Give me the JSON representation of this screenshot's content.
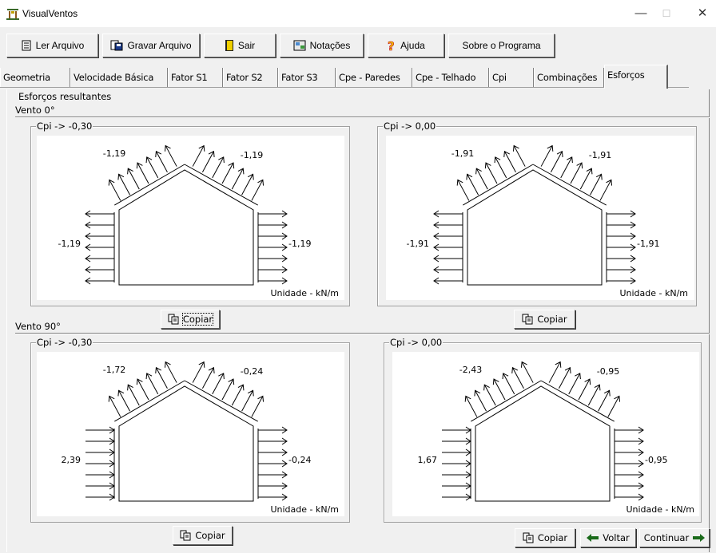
{
  "window": {
    "title": "VisualVentos",
    "minimize_glyph": "—",
    "maximize_glyph": "☐",
    "close_glyph": "✕"
  },
  "toolbar": {
    "open_label": "Ler Arquivo",
    "save_label": "Gravar Arquivo",
    "exit_label": "Sair",
    "notation_label": "Notações",
    "help_label": "Ajuda",
    "about_label": "Sobre o Programa"
  },
  "tabs": [
    "Geometria",
    "Velocidade Básica",
    "Fator S1",
    "Fator S2",
    "Fator S3",
    "Cpe - Paredes",
    "Cpe - Telhado",
    "Cpi",
    "Combinações",
    "Esforços"
  ],
  "active_tab": "Esforços",
  "panel_title": "Esforços resultantes",
  "unit_label": "Unidade - kN/m",
  "copy_label": "Copiar",
  "back_label": "Voltar",
  "continue_label": "Continuar",
  "sections": [
    {
      "title": "Vento 0°",
      "diagrams": [
        {
          "cpi_label": "Cpi -> -0,30",
          "left_wall": "-1,19",
          "right_wall": "-1,19",
          "left_roof": "-1,19",
          "right_roof": "-1,19",
          "left_wall_arrows": "out",
          "right_wall_arrows": "out"
        },
        {
          "cpi_label": "Cpi -> 0,00",
          "left_wall": "-1,91",
          "right_wall": "-1,91",
          "left_roof": "-1,91",
          "right_roof": "-1,91",
          "left_wall_arrows": "out",
          "right_wall_arrows": "out"
        }
      ]
    },
    {
      "title": "Vento 90°",
      "diagrams": [
        {
          "cpi_label": "Cpi -> -0,30",
          "left_wall": "2,39",
          "right_wall": "-0,24",
          "left_roof": "-1,72",
          "right_roof": "-0,24",
          "left_wall_arrows": "in",
          "right_wall_arrows": "out"
        },
        {
          "cpi_label": "Cpi -> 0,00",
          "left_wall": "1,67",
          "right_wall": "-0,95",
          "left_roof": "-2,43",
          "right_roof": "-0,95",
          "left_wall_arrows": "in",
          "right_wall_arrows": "out"
        }
      ]
    }
  ],
  "colors": {
    "face": "#f0f0f0",
    "canvas": "#ffffff",
    "ink": "#000000",
    "help_icon": "#f2c200",
    "exit_icon": "#f0d000"
  }
}
